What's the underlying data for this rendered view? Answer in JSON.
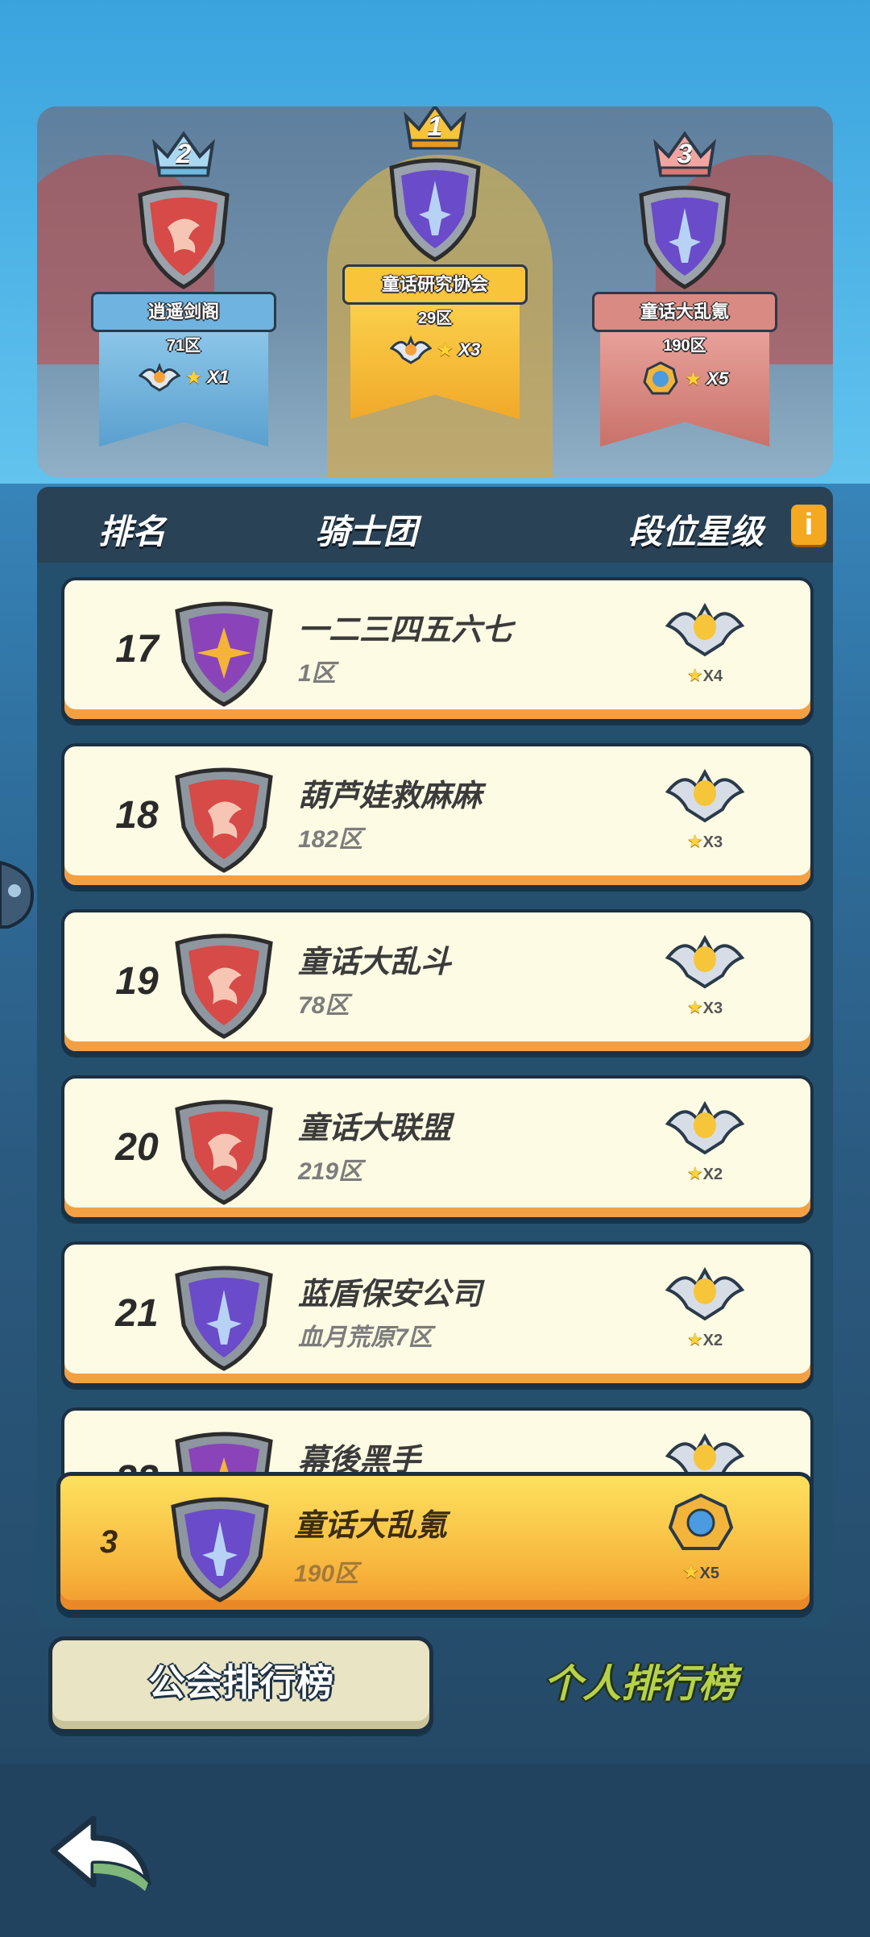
{
  "podium": [
    {
      "place": "2",
      "guild": "逍遥剑阁",
      "server": "71区",
      "multiplier": "X1",
      "color": "blue"
    },
    {
      "place": "1",
      "guild": "童话研究协会",
      "server": "29区",
      "multiplier": "X3",
      "color": "gold"
    },
    {
      "place": "3",
      "guild": "童话大乱氪",
      "server": "190区",
      "multiplier": "X5",
      "color": "red"
    }
  ],
  "header": {
    "rank_label": "排名",
    "guild_label": "骑士团",
    "tier_label": "段位星级",
    "info_label": "i"
  },
  "rows": [
    {
      "rank": "17",
      "name": "一二三四五六七",
      "server": "1区",
      "multiplier": "X4",
      "emblem": "purple-star"
    },
    {
      "rank": "18",
      "name": "葫芦娃救麻麻",
      "server": "182区",
      "multiplier": "X3",
      "emblem": "red-eagle"
    },
    {
      "rank": "19",
      "name": "童话大乱斗",
      "server": "78区",
      "multiplier": "X3",
      "emblem": "red-eagle"
    },
    {
      "rank": "20",
      "name": "童话大联盟",
      "server": "219区",
      "multiplier": "X2",
      "emblem": "red-eagle"
    },
    {
      "rank": "21",
      "name": "蓝盾保安公司",
      "server": "血月荒原7区",
      "multiplier": "X2",
      "emblem": "purple-sword"
    },
    {
      "rank": "22",
      "name": "幕後黑手",
      "server": "",
      "multiplier": "",
      "emblem": "purple-star"
    }
  ],
  "my_guild": {
    "rank": "3",
    "name": "童话大乱氪",
    "server": "190区",
    "multiplier": "X5"
  },
  "tabs": {
    "guild": "公会排行榜",
    "personal": "个人排行榜"
  },
  "colors": {
    "row_bg": "#fdfbe4",
    "row_accent": "#f3a045",
    "panel": "#24506e",
    "gold": "#f7b53d"
  }
}
